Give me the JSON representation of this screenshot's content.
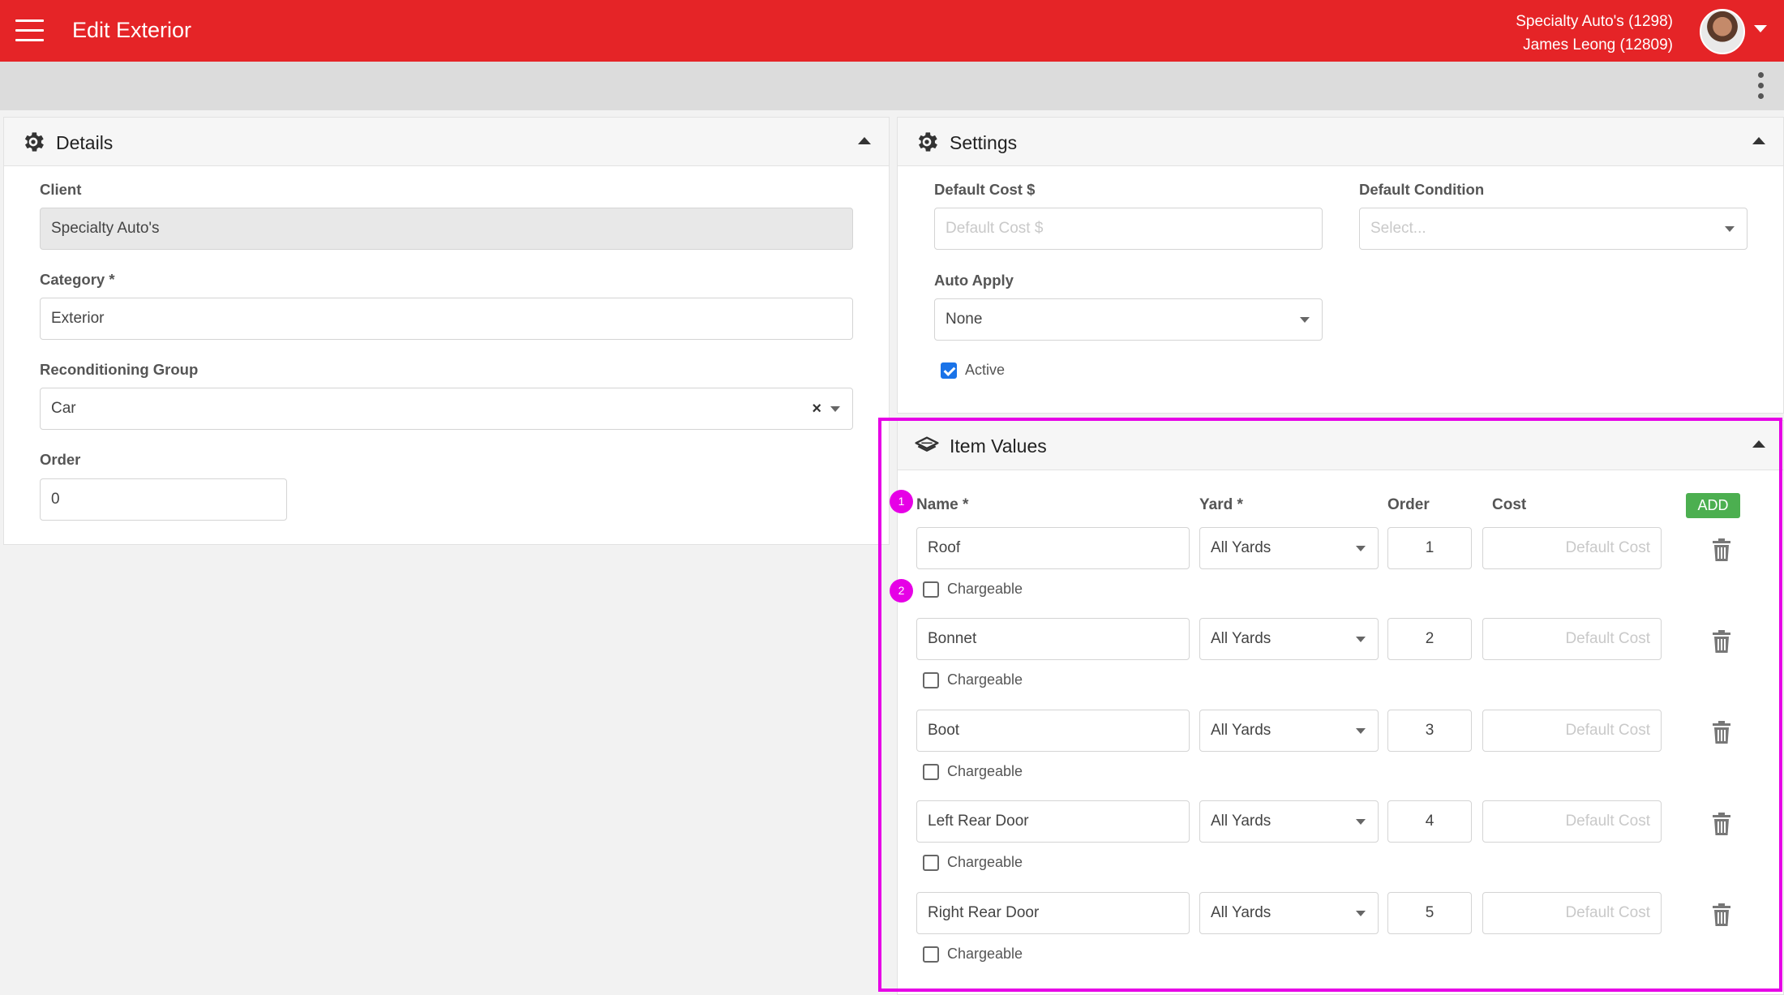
{
  "header": {
    "title": "Edit Exterior",
    "account_line1": "Specialty Auto's (1298)",
    "account_line2": "James Leong (12809)",
    "brand_color": "#e52427"
  },
  "details": {
    "title": "Details",
    "client_label": "Client",
    "client_value": "Specialty Auto's",
    "category_label": "Category *",
    "category_value": "Exterior",
    "group_label": "Reconditioning Group",
    "group_value": "Car",
    "order_label": "Order",
    "order_value": "0"
  },
  "settings": {
    "title": "Settings",
    "default_cost_label": "Default Cost $",
    "default_cost_placeholder": "Default Cost $",
    "default_condition_label": "Default Condition",
    "default_condition_placeholder": "Select...",
    "auto_apply_label": "Auto Apply",
    "auto_apply_value": "None",
    "active_label": "Active",
    "active_checked": true
  },
  "item_values": {
    "title": "Item Values",
    "col_name": "Name *",
    "col_yard": "Yard *",
    "col_order": "Order",
    "col_cost": "Cost",
    "add_label": "ADD",
    "cost_placeholder": "Default Cost",
    "chargeable_label": "Chargeable",
    "rows": [
      {
        "name": "Roof",
        "yard": "All Yards",
        "order": "1",
        "chargeable": false
      },
      {
        "name": "Bonnet",
        "yard": "All Yards",
        "order": "2",
        "chargeable": false
      },
      {
        "name": "Boot",
        "yard": "All Yards",
        "order": "3",
        "chargeable": false
      },
      {
        "name": "Left Rear Door",
        "yard": "All Yards",
        "order": "4",
        "chargeable": false
      },
      {
        "name": "Right Rear Door",
        "yard": "All Yards",
        "order": "5",
        "chargeable": false
      }
    ]
  },
  "annotations": {
    "badge1": "1",
    "badge2": "2",
    "highlight_color": "#e600e6"
  }
}
